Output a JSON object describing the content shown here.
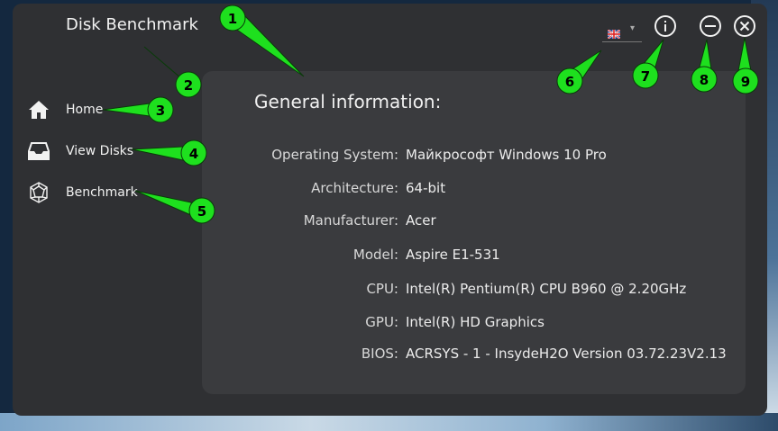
{
  "app": {
    "title": "Disk Benchmark"
  },
  "nav": {
    "items": [
      {
        "label": "Home",
        "icon": "home-icon"
      },
      {
        "label": "View Disks",
        "icon": "inbox-tray-icon"
      },
      {
        "label": "Benchmark",
        "icon": "geodesic-sphere-icon"
      }
    ]
  },
  "panel": {
    "title": "General information:",
    "rows": [
      {
        "label": "Operating System:",
        "value": "Майкрософт Windows 10 Pro"
      },
      {
        "label": "Architecture:",
        "value": "64-bit"
      },
      {
        "label": "Manufacturer:",
        "value": "Acer"
      },
      {
        "label": "Model:",
        "value": "Aspire E1-531"
      },
      {
        "label": "CPU:",
        "value": "Intel(R) Pentium(R) CPU B960 @ 2.20GHz"
      },
      {
        "label": "GPU:",
        "value": "Intel(R) HD Graphics"
      },
      {
        "label": "BIOS:",
        "value": "ACRSYS - 1 - InsydeH2O Version 03.72.23V2.13"
      }
    ]
  },
  "controls": {
    "language_flag": "uk-flag-icon",
    "info": "info-icon",
    "minimize": "minimize-icon",
    "close": "close-icon"
  },
  "callouts": [
    "1",
    "2",
    "3",
    "4",
    "5",
    "6",
    "7",
    "8",
    "9"
  ],
  "colors": {
    "callout_fill": "#1ee01e",
    "window_bg": "#2f3033",
    "panel_bg": "#3a3b3e"
  }
}
